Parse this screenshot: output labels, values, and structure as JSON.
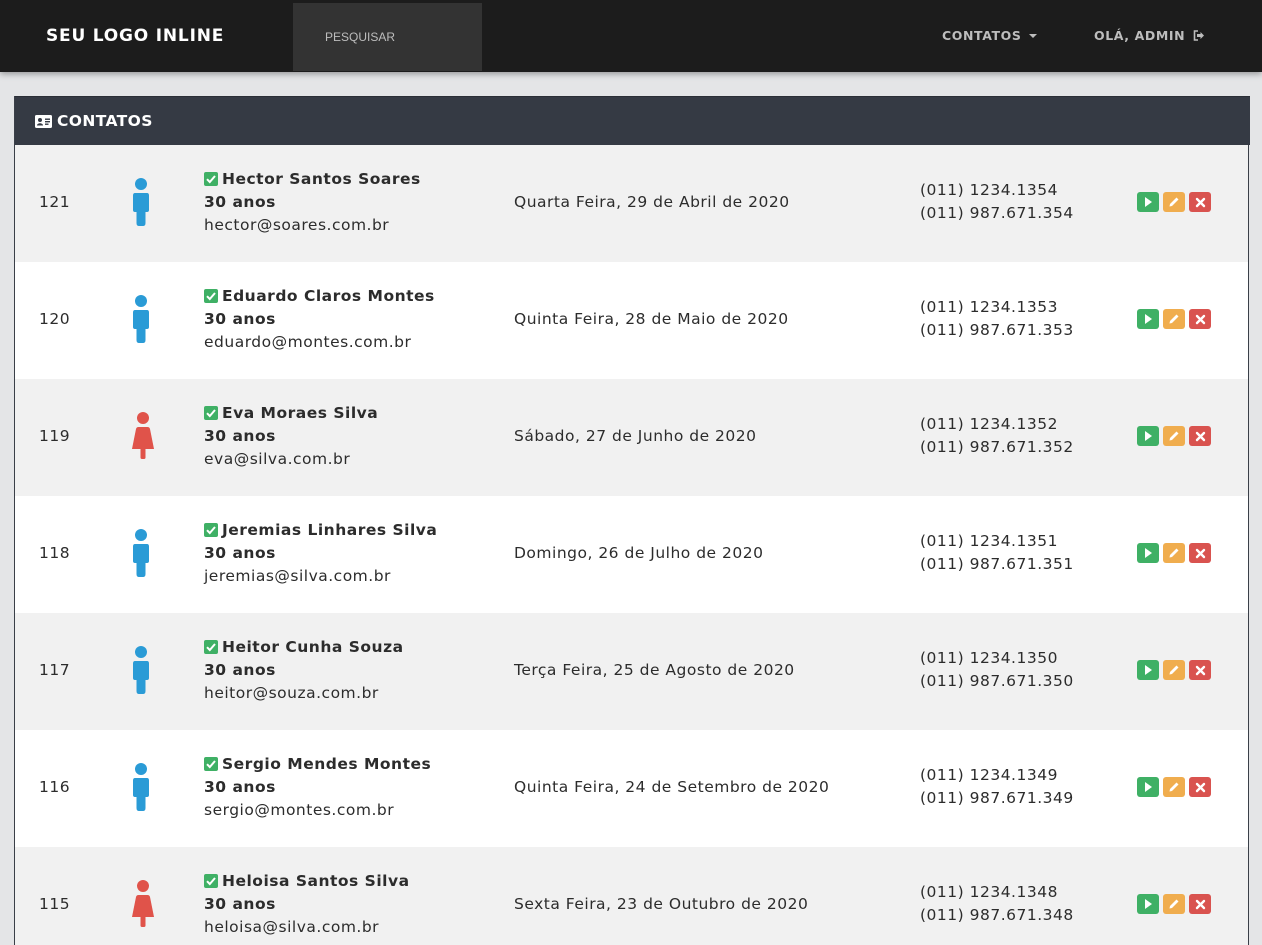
{
  "navbar": {
    "brand": "SEU LOGO INLINE",
    "search_placeholder": "PESQUISAR",
    "contacts_menu": "CONTATOS",
    "greeting": "OLÁ, ADMIN"
  },
  "panel": {
    "title": "CONTATOS"
  },
  "colors": {
    "male": "#2a9bd6",
    "female": "#e0534a",
    "check": "#3fb065",
    "view": "#3fb065",
    "edit": "#f0ad4e",
    "delete": "#d9534f"
  },
  "contacts": [
    {
      "id": "121",
      "gender": "male",
      "name": "Hector Santos Soares",
      "age": "30 anos",
      "email": "hector@soares.com.br",
      "date": "Quarta Feira, 29 de Abril de 2020",
      "phone1": "(011) 1234.1354",
      "phone2": "(011) 987.671.354"
    },
    {
      "id": "120",
      "gender": "male",
      "name": "Eduardo Claros Montes",
      "age": "30 anos",
      "email": "eduardo@montes.com.br",
      "date": "Quinta Feira, 28 de Maio de 2020",
      "phone1": "(011) 1234.1353",
      "phone2": "(011) 987.671.353"
    },
    {
      "id": "119",
      "gender": "female",
      "name": "Eva Moraes Silva",
      "age": "30 anos",
      "email": "eva@silva.com.br",
      "date": "Sábado, 27 de Junho de 2020",
      "phone1": "(011) 1234.1352",
      "phone2": "(011) 987.671.352"
    },
    {
      "id": "118",
      "gender": "male",
      "name": "Jeremias Linhares Silva",
      "age": "30 anos",
      "email": "jeremias@silva.com.br",
      "date": "Domingo, 26 de Julho de 2020",
      "phone1": "(011) 1234.1351",
      "phone2": "(011) 987.671.351"
    },
    {
      "id": "117",
      "gender": "male",
      "name": "Heitor Cunha Souza",
      "age": "30 anos",
      "email": "heitor@souza.com.br",
      "date": "Terça Feira, 25 de Agosto de 2020",
      "phone1": "(011) 1234.1350",
      "phone2": "(011) 987.671.350"
    },
    {
      "id": "116",
      "gender": "male",
      "name": "Sergio Mendes Montes",
      "age": "30 anos",
      "email": "sergio@montes.com.br",
      "date": "Quinta Feira, 24 de Setembro de 2020",
      "phone1": "(011) 1234.1349",
      "phone2": "(011) 987.671.349"
    },
    {
      "id": "115",
      "gender": "female",
      "name": "Heloisa Santos Silva",
      "age": "30 anos",
      "email": "heloisa@silva.com.br",
      "date": "Sexta Feira, 23 de Outubro de 2020",
      "phone1": "(011) 1234.1348",
      "phone2": "(011) 987.671.348"
    }
  ]
}
